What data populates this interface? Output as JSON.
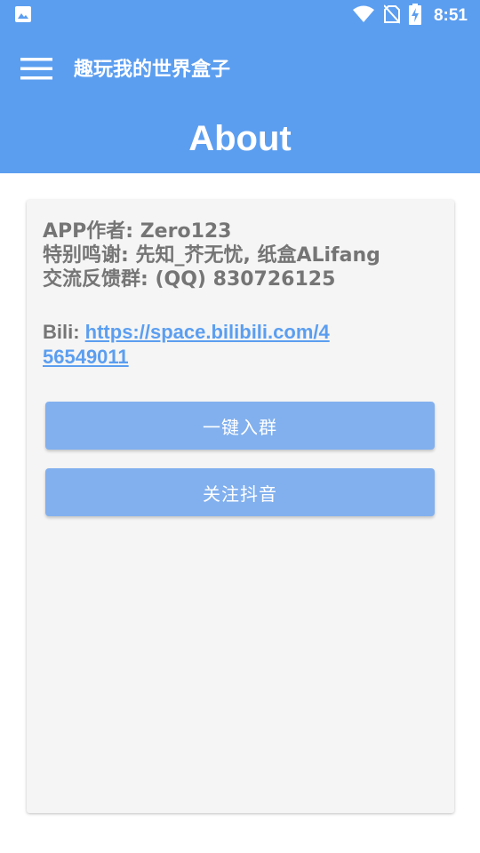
{
  "status_bar": {
    "time": "8:51",
    "icons": [
      "image-icon",
      "wifi-icon",
      "no-sim-icon",
      "battery-charging-icon"
    ]
  },
  "app_bar": {
    "title": "趣玩我的世界盒子",
    "page_title": "About",
    "menu_icon": "menu-icon"
  },
  "about": {
    "author": "APP作者: Zero123",
    "thanks": "特别鸣谢: 先知_芥无忧, 纸盒ALifang",
    "group": "交流反馈群: (QQ) 830726125",
    "bili_label": "Bili: ",
    "bili_url": "https://space.bilibili.com/456549011"
  },
  "buttons": {
    "join_group": "一键入群",
    "follow_douyin": "关注抖音"
  },
  "colors": {
    "primary": "#5b9ef0",
    "button": "#82b0ee",
    "card_bg": "#f5f5f5",
    "text_gray": "#757575"
  }
}
